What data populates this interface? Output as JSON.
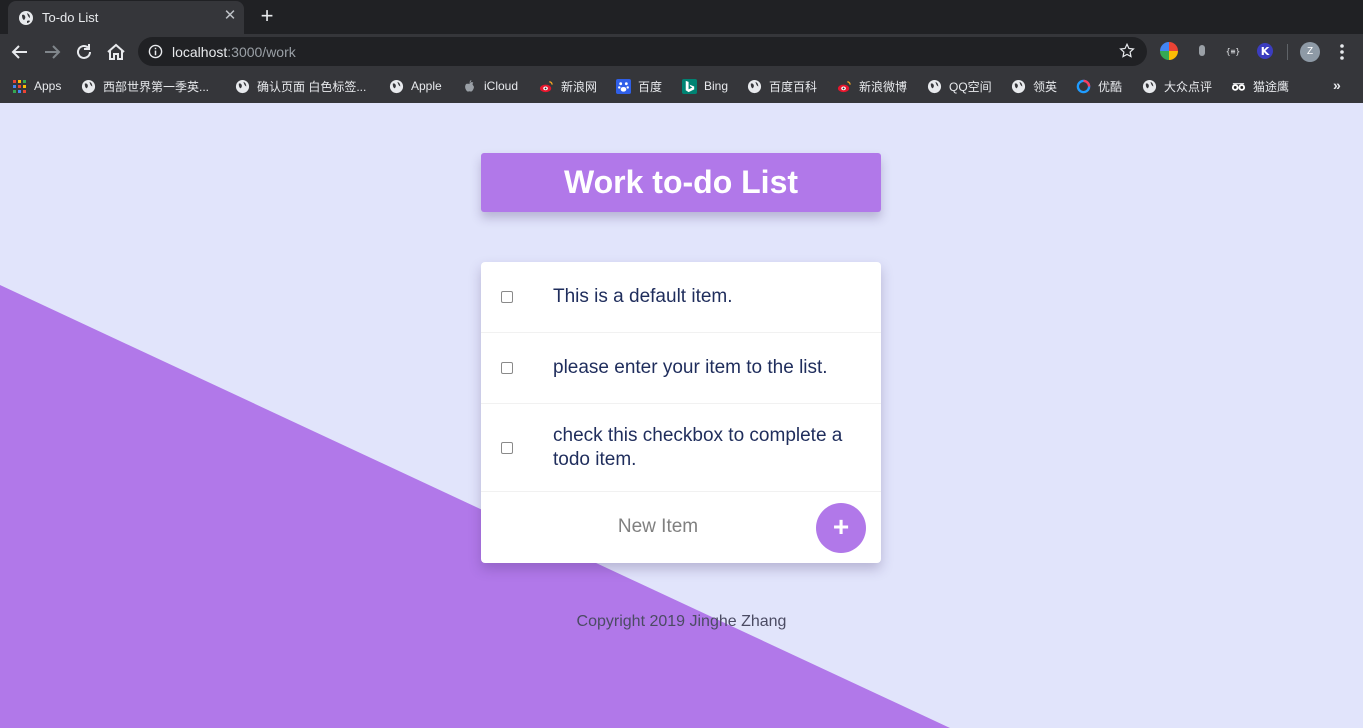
{
  "browser": {
    "tab_title": "To-do List",
    "tab_close": "✕",
    "new_tab": "+",
    "url_host": "localhost",
    "url_path": ":3000/work",
    "profile_initial": "Z",
    "bookmarks": [
      {
        "label": "Apps",
        "icon": "apps-grid-icon"
      },
      {
        "label": "西部世界第一季英...",
        "icon": "globe-icon"
      },
      {
        "label": "确认页面 白色标签...",
        "icon": "globe-icon"
      },
      {
        "label": "Apple",
        "icon": "globe-icon"
      },
      {
        "label": "iCloud",
        "icon": "apple-logo-icon"
      },
      {
        "label": "新浪网",
        "icon": "weibo-icon"
      },
      {
        "label": "百度",
        "icon": "baidu-paw-icon"
      },
      {
        "label": "Bing",
        "icon": "bing-icon"
      },
      {
        "label": "百度百科",
        "icon": "globe-icon"
      },
      {
        "label": "新浪微博",
        "icon": "weibo-icon"
      },
      {
        "label": "QQ空间",
        "icon": "globe-icon"
      },
      {
        "label": "领英",
        "icon": "globe-icon"
      },
      {
        "label": "优酷",
        "icon": "youku-icon"
      },
      {
        "label": "大众点评",
        "icon": "globe-icon"
      },
      {
        "label": "猫途鹰",
        "icon": "tripadvisor-icon"
      }
    ],
    "bookmarks_more": "»"
  },
  "page": {
    "title": "Work to-do List",
    "items": [
      {
        "text": "This is a default item.",
        "checked": false
      },
      {
        "text": "please enter your item to the list.",
        "checked": false
      },
      {
        "text": "check this checkbox to complete a todo item.",
        "checked": false
      }
    ],
    "new_item_placeholder": "New Item",
    "add_button_label": "+",
    "footer": "Copyright 2019 Jinghe Zhang"
  },
  "colors": {
    "page_background": "#e1e4fb",
    "accent_purple": "#b178e9",
    "item_text": "#1f2d5c"
  }
}
